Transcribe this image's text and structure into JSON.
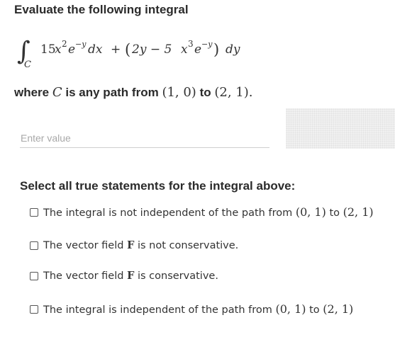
{
  "question": {
    "title": "Evaluate the following integral",
    "integral": {
      "sign": "∫",
      "path": "C",
      "term1_coef": "15",
      "term1_var": "x",
      "term1_pow": "2",
      "term1_exp_base": "e",
      "term1_exp": "−y",
      "term1_diff": "dx",
      "plus": "+",
      "term2_open": "(",
      "term2_a": "2y − 5",
      "term2_var": "x",
      "term2_pow": "3",
      "term2_exp_base": "e",
      "term2_exp": "−y",
      "term2_close": ")",
      "term2_diff": "dy"
    },
    "where_prefix": "where",
    "where_var": "C",
    "where_mid": "is any path from",
    "from_point": "(1, 0)",
    "to_word": "to",
    "to_point": "(2, 1)",
    "period": "."
  },
  "answer": {
    "placeholder": "Enter value",
    "value": ""
  },
  "statements": {
    "heading": "Select all true statements for the integral above:",
    "options": [
      {
        "pre": "The integral is not independent of the path from",
        "from": "(0, 1)",
        "to_word": "to",
        "to": "(2, 1)",
        "checked": false
      },
      {
        "pre": "The vector field",
        "field": "F",
        "post": "is not conservative.",
        "checked": false
      },
      {
        "pre": "The vector field",
        "field": "F",
        "post": "is conservative.",
        "checked": false
      },
      {
        "pre": "The integral is independent of the path from",
        "from": "(0, 1)",
        "to_word": "to",
        "to": "(2, 1)",
        "checked": false
      }
    ]
  }
}
